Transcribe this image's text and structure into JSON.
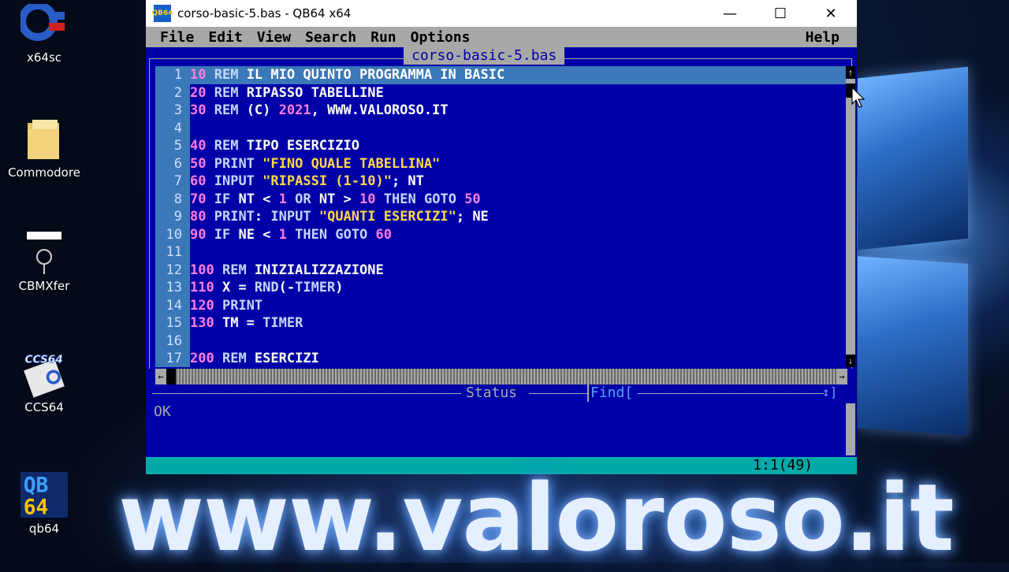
{
  "desktop": {
    "icons": [
      {
        "label": "x64sc"
      },
      {
        "label": "Commodore"
      },
      {
        "label": "CBMXfer"
      },
      {
        "label": "CCS64"
      },
      {
        "label": "qb64"
      }
    ]
  },
  "window": {
    "title": "corso-basic-5.bas - QB64 x64",
    "icon_text": "QB64",
    "controls": {
      "minimize": "—",
      "maximize": "☐",
      "close": "✕"
    }
  },
  "menu": {
    "items": [
      "File",
      "Edit",
      "View",
      "Search",
      "Run",
      "Options"
    ],
    "help": "Help"
  },
  "editor": {
    "file_tab": "corso-basic-5.bas",
    "lines": [
      {
        "n": "1",
        "html": "<span class='ln'>10</span> <span class='kw'>REM</span> IL MIO QUINTO PROGRAMMA IN BASIC"
      },
      {
        "n": "2",
        "html": "<span class='ln'>20</span> <span class='kw'>REM</span> RIPASSO TABELLINE"
      },
      {
        "n": "3",
        "html": "<span class='ln'>30</span> <span class='kw'>REM</span> (C) <span class='nu'>2021</span>, WWW.VALOROSO.IT"
      },
      {
        "n": "4",
        "html": ""
      },
      {
        "n": "5",
        "html": "<span class='ln'>40</span> <span class='kw'>REM</span> TIPO ESERCIZIO"
      },
      {
        "n": "6",
        "html": "<span class='ln'>50</span> <span class='kw'>PRINT</span> <span class='st'>\"FINO QUALE TABELLINA\"</span>"
      },
      {
        "n": "7",
        "html": "<span class='ln'>60</span> <span class='kw'>INPUT</span> <span class='st'>\"RIPASSI (1-10)\"</span>; NT"
      },
      {
        "n": "8",
        "html": "<span class='ln'>70</span> <span class='kw'>IF</span> NT &lt; <span class='nu'>1</span> <span class='kw'>OR</span> NT &gt; <span class='nu'>10</span> <span class='kw'>THEN</span> <span class='kw'>GOTO</span> <span class='nu'>50</span>"
      },
      {
        "n": "9",
        "html": "<span class='ln'>80</span> <span class='kw'>PRINT</span>: <span class='kw'>INPUT</span> <span class='st'>\"QUANTI ESERCIZI\"</span>; NE"
      },
      {
        "n": "10",
        "html": "<span class='ln'>90</span> <span class='kw'>IF</span> NE &lt; <span class='nu'>1</span> <span class='kw'>THEN</span> <span class='kw'>GOTO</span> <span class='nu'>60</span>"
      },
      {
        "n": "11",
        "html": ""
      },
      {
        "n": "12",
        "html": "<span class='ln'>100</span> <span class='kw'>REM</span> INIZIALIZZAZIONE"
      },
      {
        "n": "13",
        "html": "<span class='ln'>110</span> X = <span class='kw'>RND</span>(-<span class='kw'>TIMER</span>)"
      },
      {
        "n": "14",
        "html": "<span class='ln'>120</span> <span class='kw'>PRINT</span>"
      },
      {
        "n": "15",
        "html": "<span class='ln'>130</span> TM = <span class='kw'>TIMER</span>"
      },
      {
        "n": "16",
        "html": ""
      },
      {
        "n": "17",
        "html": "<span class='ln'>200</span> <span class='kw'>REM</span> ESERCIZI"
      }
    ],
    "current_line": 1
  },
  "status": {
    "title": "Status",
    "find_label": "Find[",
    "find_arrows": "↕]",
    "message": "OK",
    "position": "1:1(49)"
  },
  "watermark": "www.valoroso.it",
  "colors": {
    "editor_bg": "#0000a8",
    "menu_bg": "#a8a8a8",
    "bottom_bar": "#00a8a8",
    "line_number": "#ff7de0",
    "string": "#ffd84a"
  }
}
